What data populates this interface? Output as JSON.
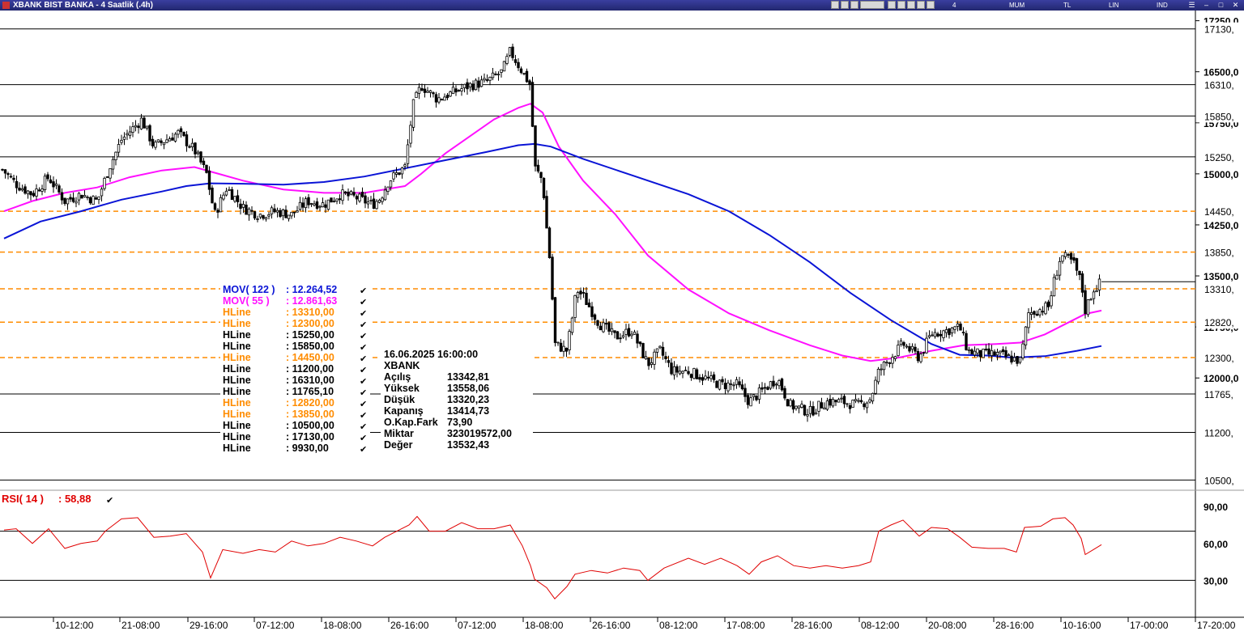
{
  "window": {
    "title": "XBANK BIST BANKA - 4 Saatlik (.4h)",
    "toolbar": {
      "period": "4 Saatlik",
      "chart_type": "MUM",
      "currency": "TL",
      "scale": "LIN",
      "indicators": "IND"
    }
  },
  "colors": {
    "blue": "#0a14d6",
    "magenta": "#ff10ff",
    "orange": "#ff8c00",
    "rsi": "#e00000",
    "black": "#000000"
  },
  "price_axis": {
    "ticks": [
      "17250,0",
      "16500,0",
      "15750,0",
      "15000,0",
      "14250,0",
      "13500,0",
      "12750,0",
      "12000,0"
    ],
    "hline_labels": [
      "17130,",
      "16310,",
      "15850,",
      "15250,",
      "14450,",
      "13850,",
      "13310,",
      "12820,",
      "12300,",
      "11765,",
      "11200,",
      "10500,"
    ]
  },
  "time_axis": [
    "10-12:00",
    "21-08:00",
    "29-16:00",
    "07-12:00",
    "18-08:00",
    "26-16:00",
    "07-12:00",
    "18-08:00",
    "26-16:00",
    "08-12:00",
    "17-08:00",
    "28-16:00",
    "08-12:00",
    "20-08:00",
    "28-16:00",
    "10-16:00",
    "17-00:00",
    "17-20:00"
  ],
  "rsi_axis": {
    "ticks": [
      "90,00",
      "60,00",
      "30,00"
    ],
    "label": "RSI( 14 )",
    "value": ": 58,88"
  },
  "legend": [
    {
      "name": "MOV( 122 )",
      "value": ": 12.264,52",
      "color": "#0a14d6"
    },
    {
      "name": "MOV( 55 )",
      "value": ": 12.861,63",
      "color": "#ff10ff"
    },
    {
      "name": "HLine",
      "value": ": 13310,00",
      "color": "#ff8c00"
    },
    {
      "name": "HLine",
      "value": ": 12300,00",
      "color": "#ff8c00"
    },
    {
      "name": "HLine",
      "value": ": 15250,00",
      "color": "#000000"
    },
    {
      "name": "HLine",
      "value": ": 15850,00",
      "color": "#000000"
    },
    {
      "name": "HLine",
      "value": ": 14450,00",
      "color": "#ff8c00"
    },
    {
      "name": "HLine",
      "value": ": 11200,00",
      "color": "#000000"
    },
    {
      "name": "HLine",
      "value": ": 16310,00",
      "color": "#000000"
    },
    {
      "name": "HLine",
      "value": ": 11765,10",
      "color": "#000000"
    },
    {
      "name": "HLine",
      "value": ": 12820,00",
      "color": "#ff8c00"
    },
    {
      "name": "HLine",
      "value": ": 13850,00",
      "color": "#ff8c00"
    },
    {
      "name": "HLine",
      "value": ": 10500,00",
      "color": "#000000"
    },
    {
      "name": "HLine",
      "value": ": 17130,00",
      "color": "#000000"
    },
    {
      "name": "HLine",
      "value": ": 9930,00",
      "color": "#000000"
    }
  ],
  "info": {
    "datetime": "16.06.2025  16:00:00",
    "symbol": "XBANK",
    "rows": [
      {
        "label": "Açılış",
        "value": "13342,81"
      },
      {
        "label": "Yüksek",
        "value": "13558,06"
      },
      {
        "label": "Düşük",
        "value": "13320,23"
      },
      {
        "label": "Kapanış",
        "value": "13414,73"
      },
      {
        "label": "O.Kap.Fark",
        "value": "73,90"
      },
      {
        "label": "Miktar",
        "value": "323019572,00"
      },
      {
        "label": "Değer",
        "value": "13532,43"
      }
    ]
  },
  "chart_data": {
    "type": "candlestick",
    "ylim": [
      10350,
      17400
    ],
    "hlines": [
      {
        "value": 17130,
        "style": "solid",
        "color": "#000000"
      },
      {
        "value": 16310,
        "style": "solid",
        "color": "#000000"
      },
      {
        "value": 15850,
        "style": "solid",
        "color": "#000000"
      },
      {
        "value": 15250,
        "style": "solid",
        "color": "#000000"
      },
      {
        "value": 14450,
        "style": "dashed",
        "color": "#ff8c00"
      },
      {
        "value": 13850,
        "style": "dashed",
        "color": "#ff8c00"
      },
      {
        "value": 13310,
        "style": "dashed",
        "color": "#ff8c00"
      },
      {
        "value": 12820,
        "style": "dashed",
        "color": "#ff8c00"
      },
      {
        "value": 12300,
        "style": "dashed",
        "color": "#ff8c00"
      },
      {
        "value": 11765,
        "style": "solid",
        "color": "#000000"
      },
      {
        "value": 11200,
        "style": "solid",
        "color": "#000000"
      },
      {
        "value": 10500,
        "style": "solid",
        "color": "#000000"
      }
    ],
    "close_path": [
      [
        0,
        15100
      ],
      [
        20,
        14850
      ],
      [
        40,
        14700
      ],
      [
        60,
        14950
      ],
      [
        80,
        14600
      ],
      [
        100,
        14700
      ],
      [
        120,
        14600
      ],
      [
        135,
        15100
      ],
      [
        150,
        15500
      ],
      [
        175,
        15800
      ],
      [
        190,
        15400
      ],
      [
        205,
        15500
      ],
      [
        220,
        15600
      ],
      [
        240,
        15350
      ],
      [
        255,
        15000
      ],
      [
        265,
        14400
      ],
      [
        280,
        14800
      ],
      [
        300,
        14500
      ],
      [
        320,
        14400
      ],
      [
        340,
        14450
      ],
      [
        360,
        14400
      ],
      [
        380,
        14600
      ],
      [
        400,
        14550
      ],
      [
        420,
        14700
      ],
      [
        440,
        14650
      ],
      [
        460,
        14550
      ],
      [
        470,
        14650
      ],
      [
        480,
        14900
      ],
      [
        500,
        15100
      ],
      [
        510,
        16000
      ],
      [
        520,
        16300
      ],
      [
        540,
        16100
      ],
      [
        560,
        16200
      ],
      [
        580,
        16300
      ],
      [
        600,
        16350
      ],
      [
        620,
        16500
      ],
      [
        630,
        16800
      ],
      [
        645,
        16500
      ],
      [
        655,
        16300
      ],
      [
        660,
        15100
      ],
      [
        670,
        14900
      ],
      [
        675,
        14200
      ],
      [
        680,
        13600
      ],
      [
        685,
        12500
      ],
      [
        700,
        12400
      ],
      [
        712,
        13300
      ],
      [
        720,
        13200
      ],
      [
        740,
        12800
      ],
      [
        760,
        12600
      ],
      [
        780,
        12700
      ],
      [
        800,
        12200
      ],
      [
        815,
        12400
      ],
      [
        830,
        12100
      ],
      [
        850,
        12100
      ],
      [
        870,
        12000
      ],
      [
        890,
        11900
      ],
      [
        910,
        11900
      ],
      [
        925,
        11650
      ],
      [
        940,
        11800
      ],
      [
        960,
        12000
      ],
      [
        975,
        11600
      ],
      [
        1000,
        11500
      ],
      [
        1020,
        11650
      ],
      [
        1040,
        11650
      ],
      [
        1060,
        11600
      ],
      [
        1075,
        11700
      ],
      [
        1085,
        12100
      ],
      [
        1100,
        12300
      ],
      [
        1115,
        12500
      ],
      [
        1135,
        12300
      ],
      [
        1150,
        12650
      ],
      [
        1170,
        12700
      ],
      [
        1185,
        12750
      ],
      [
        1195,
        12400
      ],
      [
        1210,
        12350
      ],
      [
        1230,
        12350
      ],
      [
        1245,
        12300
      ],
      [
        1260,
        12250
      ],
      [
        1270,
        12950
      ],
      [
        1295,
        13050
      ],
      [
        1300,
        13350
      ],
      [
        1310,
        13800
      ],
      [
        1325,
        13700
      ],
      [
        1335,
        13400
      ],
      [
        1340,
        13000
      ],
      [
        1350,
        13300
      ],
      [
        1360,
        13414
      ]
    ],
    "ma122": [
      [
        5,
        14050
      ],
      [
        50,
        14300
      ],
      [
        100,
        14450
      ],
      [
        150,
        14620
      ],
      [
        200,
        14740
      ],
      [
        230,
        14820
      ],
      [
        260,
        14860
      ],
      [
        300,
        14855
      ],
      [
        350,
        14840
      ],
      [
        400,
        14880
      ],
      [
        450,
        14960
      ],
      [
        500,
        15080
      ],
      [
        550,
        15200
      ],
      [
        600,
        15320
      ],
      [
        640,
        15420
      ],
      [
        660,
        15440
      ],
      [
        680,
        15400
      ],
      [
        720,
        15220
      ],
      [
        780,
        14980
      ],
      [
        850,
        14700
      ],
      [
        900,
        14450
      ],
      [
        950,
        14100
      ],
      [
        1000,
        13700
      ],
      [
        1050,
        13250
      ],
      [
        1100,
        12850
      ],
      [
        1150,
        12500
      ],
      [
        1185,
        12340
      ],
      [
        1220,
        12330
      ],
      [
        1250,
        12300
      ],
      [
        1290,
        12320
      ],
      [
        1330,
        12400
      ],
      [
        1360,
        12470
      ]
    ],
    "ma55": [
      [
        5,
        14450
      ],
      [
        40,
        14600
      ],
      [
        80,
        14720
      ],
      [
        120,
        14800
      ],
      [
        160,
        14950
      ],
      [
        200,
        15050
      ],
      [
        240,
        15100
      ],
      [
        270,
        15000
      ],
      [
        300,
        14900
      ],
      [
        350,
        14770
      ],
      [
        400,
        14720
      ],
      [
        450,
        14720
      ],
      [
        500,
        14820
      ],
      [
        520,
        15000
      ],
      [
        550,
        15300
      ],
      [
        580,
        15550
      ],
      [
        610,
        15800
      ],
      [
        640,
        15970
      ],
      [
        655,
        16030
      ],
      [
        670,
        15900
      ],
      [
        690,
        15400
      ],
      [
        720,
        14900
      ],
      [
        760,
        14400
      ],
      [
        800,
        13800
      ],
      [
        850,
        13300
      ],
      [
        900,
        12950
      ],
      [
        950,
        12700
      ],
      [
        1000,
        12480
      ],
      [
        1040,
        12330
      ],
      [
        1075,
        12250
      ],
      [
        1110,
        12300
      ],
      [
        1150,
        12400
      ],
      [
        1190,
        12480
      ],
      [
        1230,
        12500
      ],
      [
        1260,
        12520
      ],
      [
        1290,
        12640
      ],
      [
        1320,
        12820
      ],
      [
        1340,
        12940
      ],
      [
        1360,
        12990
      ]
    ],
    "rsi": [
      [
        5,
        71
      ],
      [
        20,
        72
      ],
      [
        40,
        60
      ],
      [
        60,
        72
      ],
      [
        80,
        56
      ],
      [
        100,
        60
      ],
      [
        120,
        62
      ],
      [
        130,
        70
      ],
      [
        150,
        80
      ],
      [
        170,
        81
      ],
      [
        190,
        65
      ],
      [
        210,
        66
      ],
      [
        230,
        68
      ],
      [
        250,
        53
      ],
      [
        260,
        32
      ],
      [
        275,
        55
      ],
      [
        300,
        52
      ],
      [
        320,
        55
      ],
      [
        340,
        53
      ],
      [
        360,
        62
      ],
      [
        380,
        58
      ],
      [
        400,
        60
      ],
      [
        420,
        65
      ],
      [
        440,
        62
      ],
      [
        460,
        58
      ],
      [
        475,
        65
      ],
      [
        490,
        70
      ],
      [
        505,
        75
      ],
      [
        515,
        82
      ],
      [
        530,
        70
      ],
      [
        550,
        70
      ],
      [
        570,
        77
      ],
      [
        590,
        72
      ],
      [
        610,
        72
      ],
      [
        630,
        75
      ],
      [
        645,
        58
      ],
      [
        655,
        42
      ],
      [
        660,
        31
      ],
      [
        675,
        24
      ],
      [
        685,
        15
      ],
      [
        700,
        25
      ],
      [
        710,
        35
      ],
      [
        730,
        38
      ],
      [
        750,
        36
      ],
      [
        770,
        40
      ],
      [
        790,
        38
      ],
      [
        800,
        30
      ],
      [
        820,
        40
      ],
      [
        850,
        48
      ],
      [
        870,
        43
      ],
      [
        890,
        48
      ],
      [
        910,
        42
      ],
      [
        925,
        35
      ],
      [
        940,
        45
      ],
      [
        960,
        50
      ],
      [
        980,
        42
      ],
      [
        1000,
        40
      ],
      [
        1020,
        42
      ],
      [
        1040,
        40
      ],
      [
        1060,
        42
      ],
      [
        1075,
        45
      ],
      [
        1085,
        70
      ],
      [
        1100,
        75
      ],
      [
        1115,
        79
      ],
      [
        1135,
        66
      ],
      [
        1150,
        73
      ],
      [
        1170,
        72
      ],
      [
        1185,
        65
      ],
      [
        1200,
        57
      ],
      [
        1220,
        56
      ],
      [
        1240,
        56
      ],
      [
        1255,
        53
      ],
      [
        1265,
        73
      ],
      [
        1285,
        74
      ],
      [
        1300,
        80
      ],
      [
        1315,
        81
      ],
      [
        1325,
        75
      ],
      [
        1335,
        64
      ],
      [
        1340,
        51
      ],
      [
        1350,
        55
      ],
      [
        1360,
        59
      ]
    ],
    "rsi_ylim": [
      0,
      100
    ],
    "rsi_refs": [
      70,
      30
    ]
  }
}
